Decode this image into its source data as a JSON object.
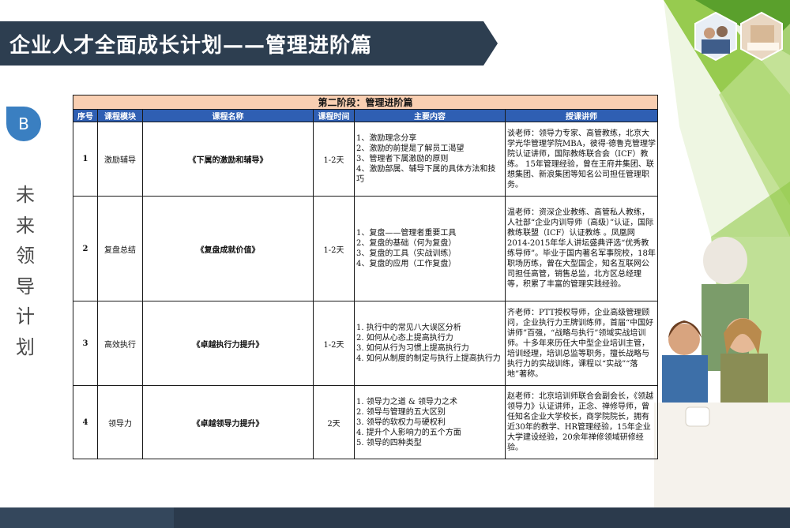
{
  "header": {
    "title": "企业人才全面成长计划——管理进阶篇"
  },
  "sidebar": {
    "badge": "B",
    "vertical_text": [
      "未",
      "来",
      "领",
      "导",
      "计",
      "划"
    ]
  },
  "table": {
    "stage_title": "第二阶段：管理进阶篇",
    "columns": [
      "序号",
      "课程模块",
      "课程名称",
      "课程时间",
      "主要内容",
      "授课讲师"
    ],
    "rows": [
      {
        "no": "1",
        "module": "激励辅导",
        "course": "《下属的激励和辅导》",
        "duration": "1-2天",
        "content": [
          "1、激励理念分享",
          "2、激励的前提是了解员工渴望",
          "3、管理者下属激励的原则",
          "4、激励部属、辅导下属的具体方法和技巧"
        ],
        "teacher": "谈老师：领导力专家、高管教练，北京大学光华管理学院MBA，彼得·德鲁克管理学院认证讲师，国际教练联合会（ICF）教练。 15年管理经验，曾在王府井集团、联想集团、新浪集团等知名公司担任管理职务。"
      },
      {
        "no": "2",
        "module": "复盘总结",
        "course": "《复盘成就价值》",
        "duration": "1-2天",
        "content": [
          "1、复盘——管理者重要工具",
          "2、复盘的基础（何为复盘）",
          "3、复盘的工具（实战训练）",
          "4、复盘的应用（工作复盘）"
        ],
        "teacher": "温老师：资深企业教练、高管私人教练，人社部“企业内训导师（高级）”认证，国际教练联盟（ICF）认证教练 。凤凰网2014-2015年华人讲坛盛典评选“优秀教练导师”。毕业于国内著名军事院校，18年职场历练，曾在大型国企，知名互联网公司担任高管，销售总监，北方区总经理等，积累了丰富的管理实践经验。"
      },
      {
        "no": "3",
        "module": "高效执行",
        "course": "《卓越执行力提升》",
        "duration": "1-2天",
        "content": [
          "1. 执行中的常见八大误区分析",
          "2. 如何从心态上提高执行力",
          "3. 如何从行为习惯上提高执行力",
          "4. 如何从制度的制定与执行上提高执行力"
        ],
        "teacher": "齐老师：PTT授权导师，企业高级管理顾问，企业执行力王牌训练师，首届“中国好讲师”百强，“战略与执行”领域实战培训师。十多年来历任大中型企业培训主管，培训经理，培训总监等职务，擅长战略与执行力的实战训练，课程以“实战”“落地”著称。"
      },
      {
        "no": "4",
        "module": "领导力",
        "course": "《卓越领导力提升》",
        "duration": "2天",
        "content": [
          "1. 领导力之道 & 领导力之术",
          "2. 领导与管理的五大区别",
          "3. 领导的软权力与硬权利",
          "4. 提升个人影响力的五个方面",
          "5. 领导的四种类型"
        ],
        "teacher": "赵老师：北京培训师联合会副会长，《领越领导力》认证讲师，正念、禅修导师，曾任知名企业大学校长，商学院院长，拥有近30年的教学、HR管理经验，15年企业大学建设经验，20余年禅修领域研修经验。"
      }
    ]
  },
  "colors": {
    "title_bar": "#2d3e50",
    "badge": "#3a7fc1",
    "stage_header": "#f9cfb2",
    "column_header": "#2f5fb3",
    "green_accent": "#8dc63f"
  }
}
